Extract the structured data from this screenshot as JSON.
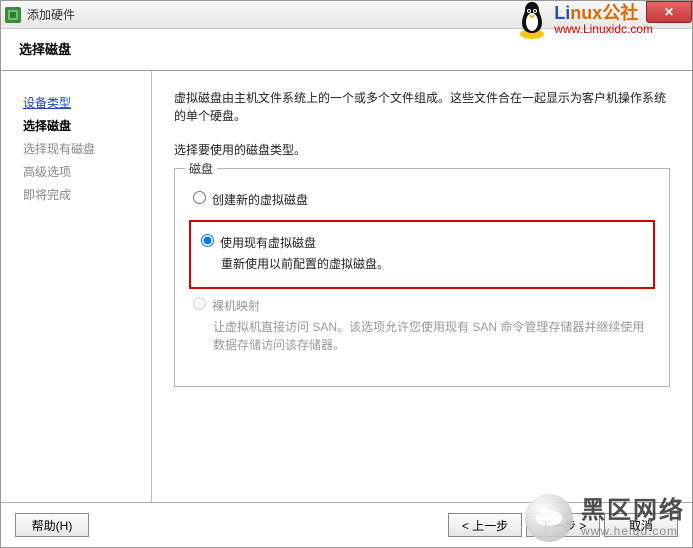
{
  "titlebar": {
    "title": "添加硬件"
  },
  "subheader": {
    "title": "选择磁盘"
  },
  "watermark_linux": {
    "brand_prefix": "Li",
    "brand_suffix": "nux",
    "tagline_prefix": "公社",
    "url": "www.Linuxidc.com"
  },
  "sidebar": {
    "steps": [
      {
        "label": "设备类型",
        "state": "link"
      },
      {
        "label": "选择磁盘",
        "state": "current"
      },
      {
        "label": "选择现有磁盘",
        "state": "pending"
      },
      {
        "label": "高级选项",
        "state": "pending"
      },
      {
        "label": "即将完成",
        "state": "pending"
      }
    ]
  },
  "content": {
    "desc": "虚拟磁盘由主机文件系统上的一个或多个文件组成。这些文件合在一起显示为客户机操作系统的单个硬盘。",
    "prompt": "选择要使用的磁盘类型。",
    "group_title": "磁盘",
    "options": {
      "create": {
        "label": "创建新的虚拟磁盘"
      },
      "existing": {
        "label": "使用现有虚拟磁盘",
        "sub": "重新使用以前配置的虚拟磁盘。"
      },
      "rdm": {
        "label": "裸机映射",
        "sub": "让虚拟机直接访问 SAN。该选项允许您使用现有 SAN 命令管理存储器并继续使用数据存储访问该存储器。"
      }
    }
  },
  "footer": {
    "help": "帮助(H)",
    "back": "< 上一步",
    "next": "下一步 >",
    "cancel": "取消"
  },
  "watermark_heiqu": {
    "ln1": "黑区网络",
    "ln2": "www.heiqu.com"
  }
}
